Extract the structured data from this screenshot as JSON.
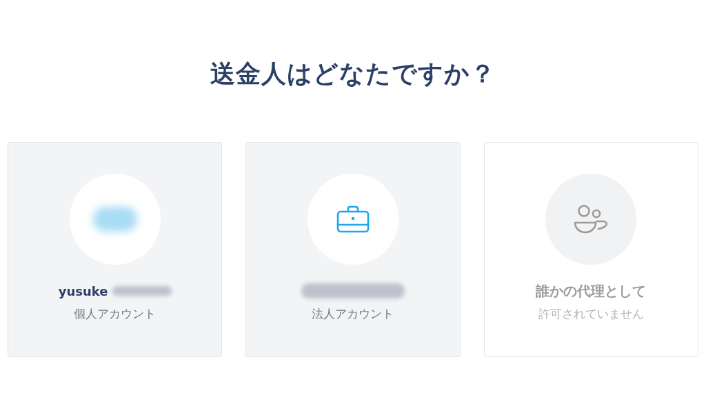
{
  "title": "送金人はどなたですか？",
  "accounts": [
    {
      "kind": "personal",
      "name": "yusuke",
      "name_redacted": true,
      "subtitle": "個人アカウント",
      "disabled": false
    },
    {
      "kind": "business",
      "name_redacted": true,
      "subtitle": "法人アカウント",
      "disabled": false
    },
    {
      "kind": "proxy",
      "name": "誰かの代理として",
      "name_redacted": false,
      "subtitle": "許可されていません",
      "disabled": true
    }
  ]
}
